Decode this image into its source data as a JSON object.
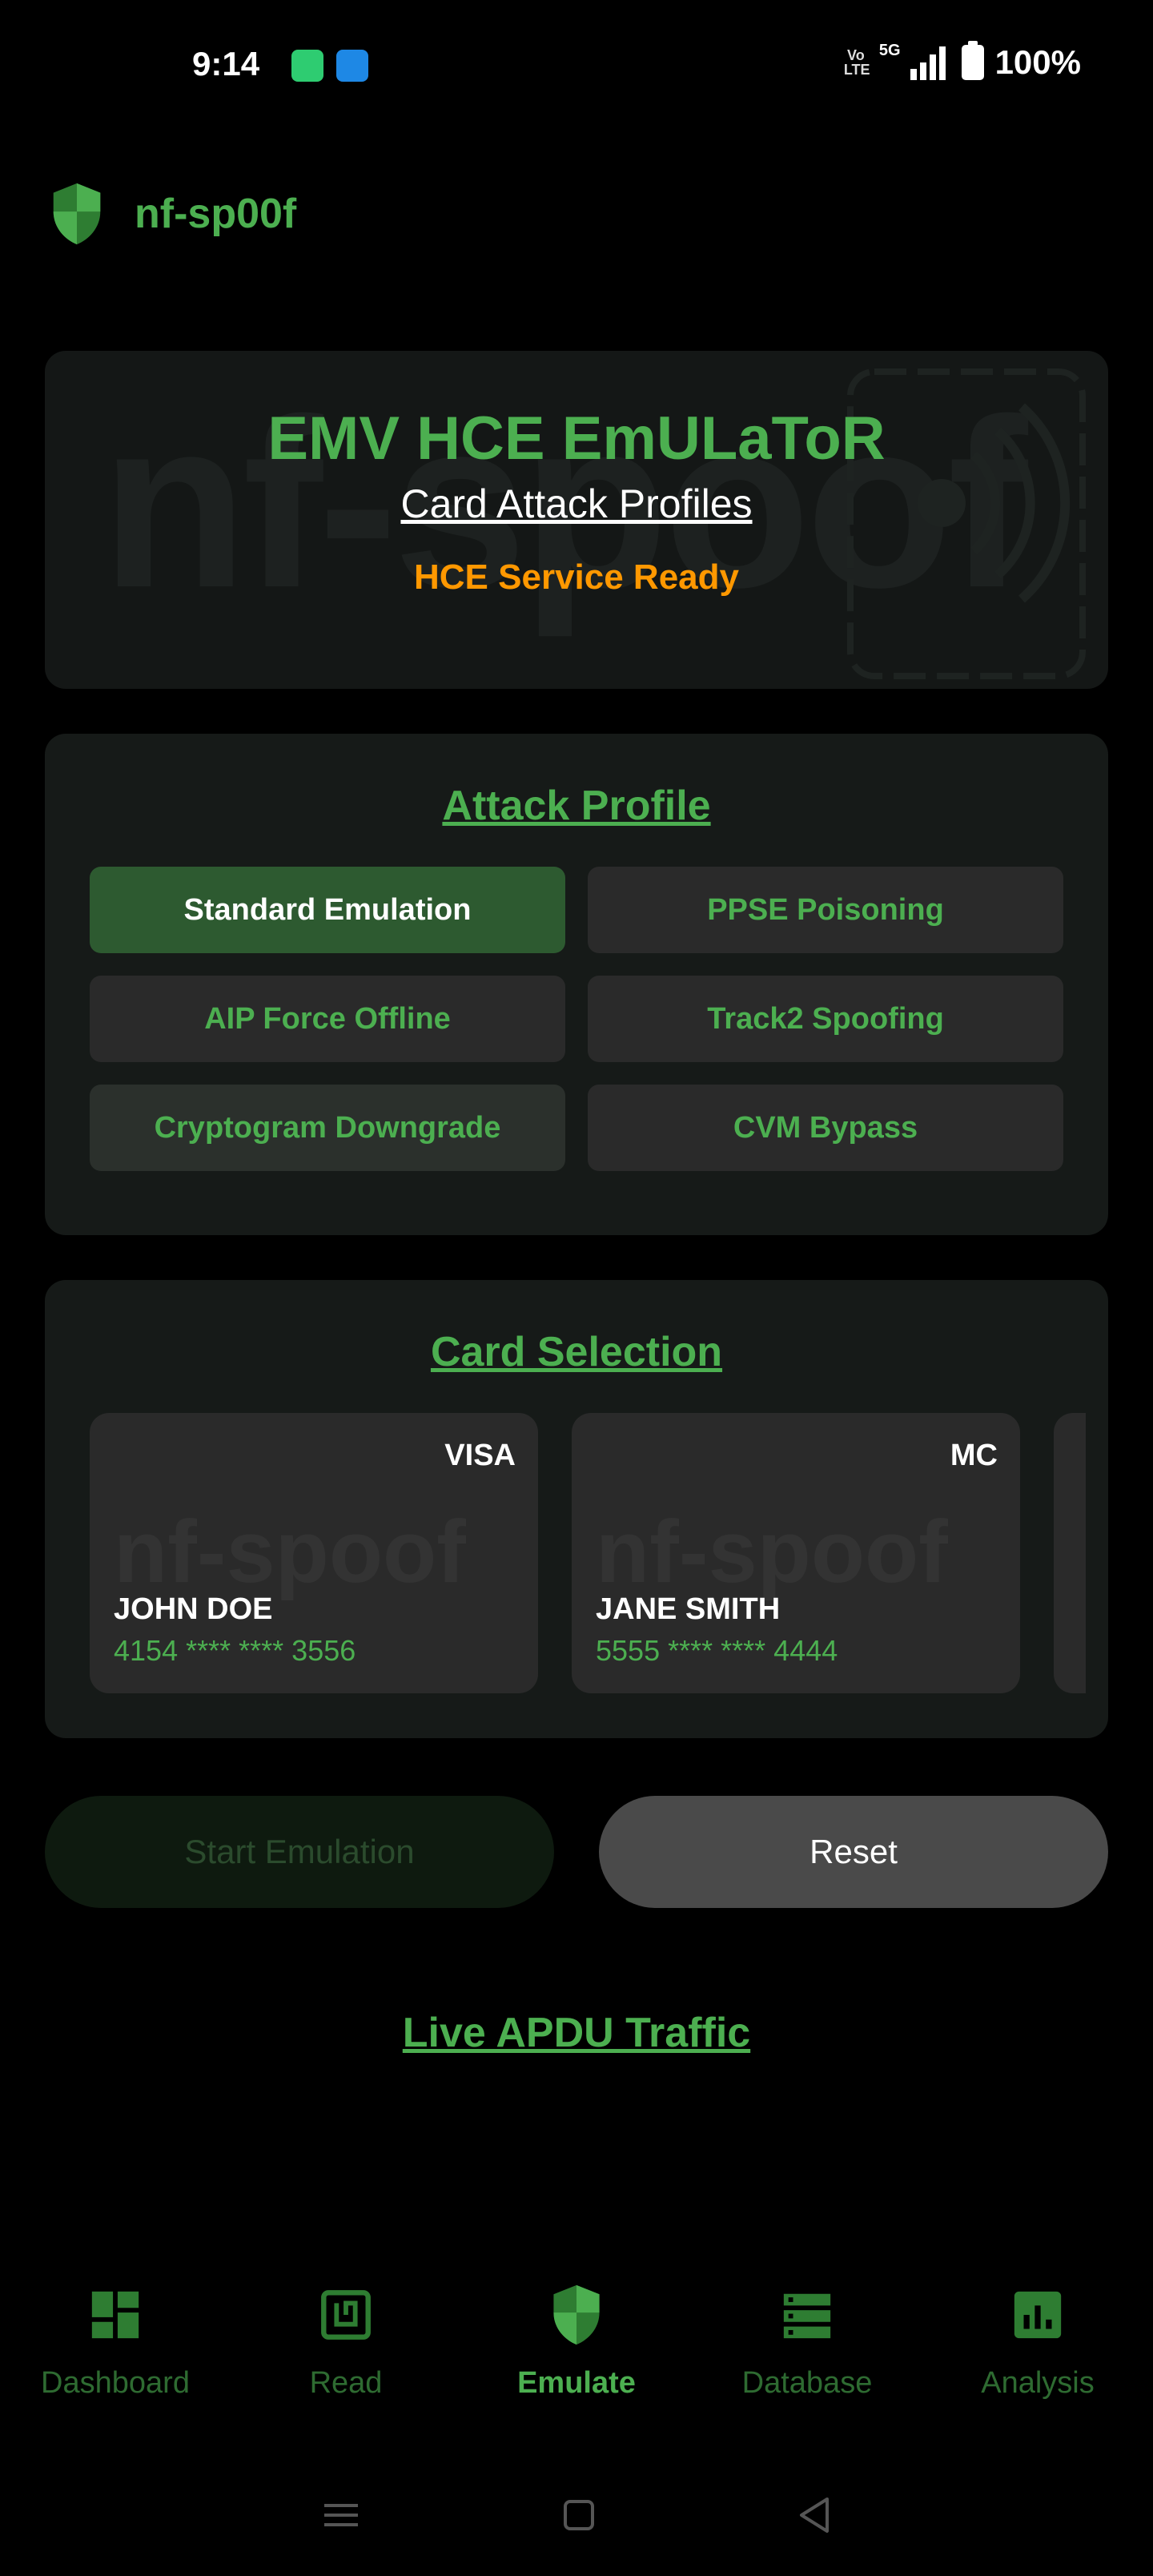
{
  "status_bar": {
    "time": "9:14",
    "network": "5G",
    "volte_top": "Vo",
    "volte_bottom": "LTE",
    "battery": "100%"
  },
  "header": {
    "app_title": "nf-sp00f",
    "icon": "shield-icon"
  },
  "hero": {
    "watermark": "nf-spoof",
    "title": "EMV HCE EmULaToR",
    "subtitle": "Card Attack Profiles",
    "status": "HCE Service Ready"
  },
  "attack_profile": {
    "title": "Attack Profile",
    "options": [
      {
        "label": "Standard Emulation",
        "state": "selected"
      },
      {
        "label": "PPSE Poisoning",
        "state": "normal"
      },
      {
        "label": "AIP Force Offline",
        "state": "normal"
      },
      {
        "label": "Track2 Spoofing",
        "state": "normal"
      },
      {
        "label": "Cryptogram Downgrade",
        "state": "pressed"
      },
      {
        "label": "CVM Bypass",
        "state": "normal"
      }
    ]
  },
  "card_selection": {
    "title": "Card Selection",
    "watermark": "nf-spoof",
    "cards": [
      {
        "brand": "VISA",
        "holder": "JOHN DOE",
        "number": "4154 **** **** 3556"
      },
      {
        "brand": "MC",
        "holder": "JANE SMITH",
        "number": "5555 **** **** 4444"
      }
    ]
  },
  "actions": {
    "start_label": "Start Emulation",
    "reset_label": "Reset"
  },
  "live_traffic": {
    "title": "Live APDU Traffic"
  },
  "bottom_nav": {
    "items": [
      {
        "label": "Dashboard",
        "icon": "dashboard-icon"
      },
      {
        "label": "Read",
        "icon": "read-icon"
      },
      {
        "label": "Emulate",
        "icon": "shield-icon",
        "active": true
      },
      {
        "label": "Database",
        "icon": "database-icon"
      },
      {
        "label": "Analysis",
        "icon": "analysis-icon"
      }
    ]
  },
  "colors": {
    "accent": "#4caf50",
    "warning": "#ff9800",
    "background": "#000000",
    "card": "#161a18"
  }
}
